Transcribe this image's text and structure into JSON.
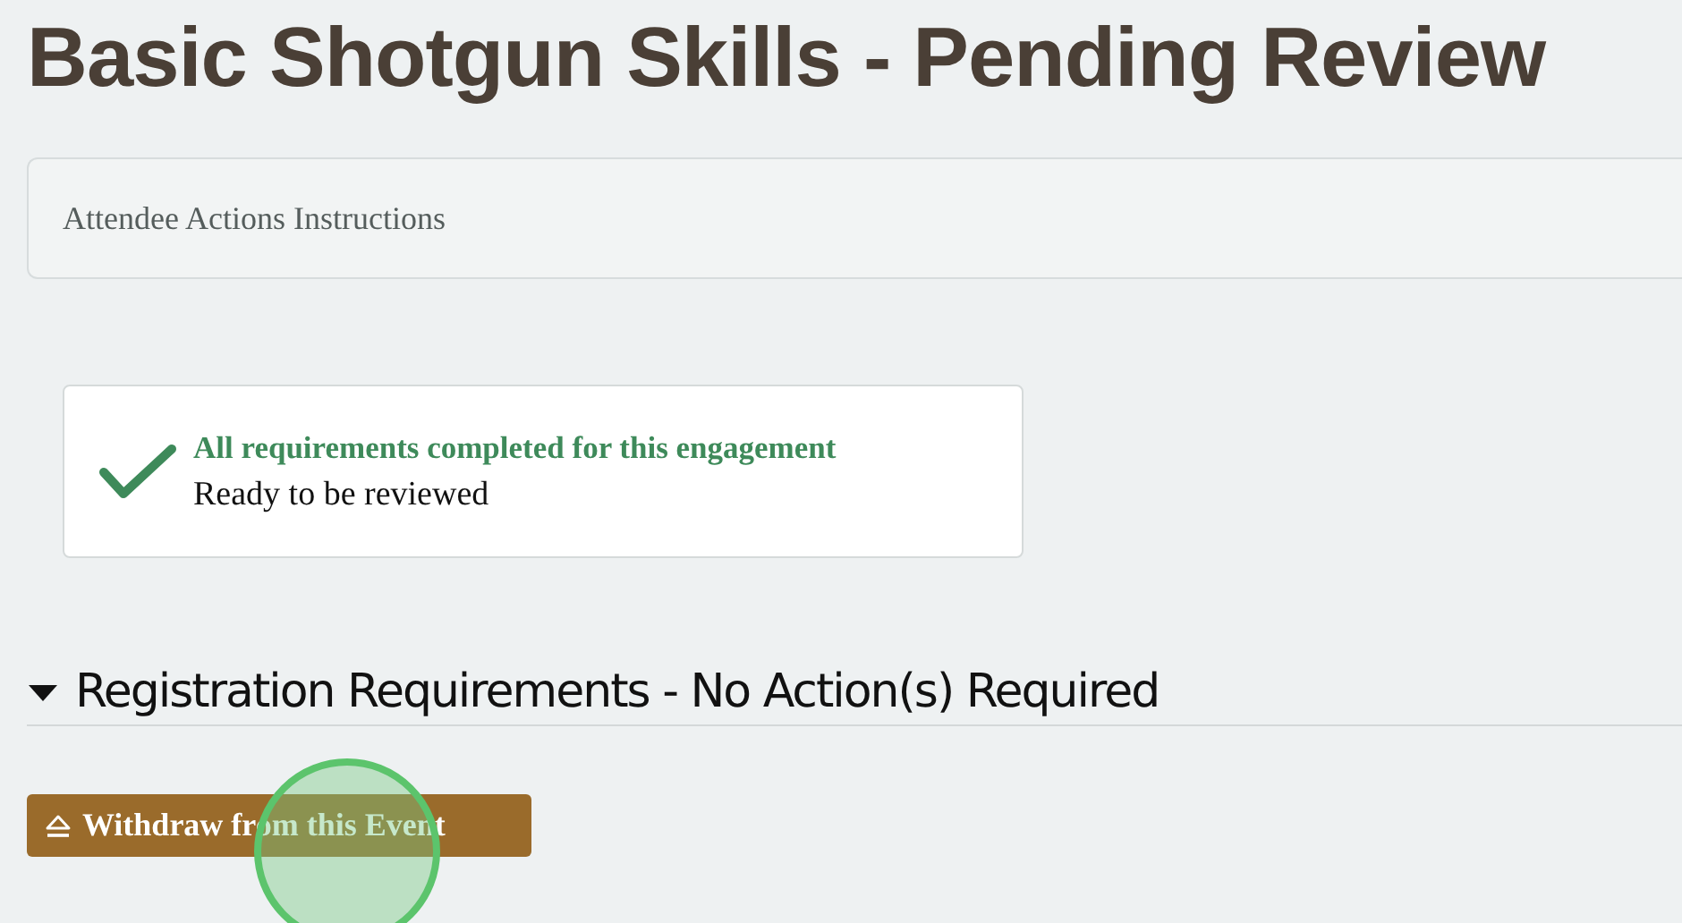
{
  "title": "Basic Shotgun Skills - Pending Review",
  "instructions_panel": {
    "label": "Attendee Actions Instructions"
  },
  "status_card": {
    "heading": "All requirements completed for this engagement",
    "message": "Ready to be reviewed"
  },
  "section": {
    "title": "Registration Requirements - No Action(s) Required",
    "expanded": true
  },
  "withdraw_button": {
    "label": "Withdraw from this Event"
  }
}
